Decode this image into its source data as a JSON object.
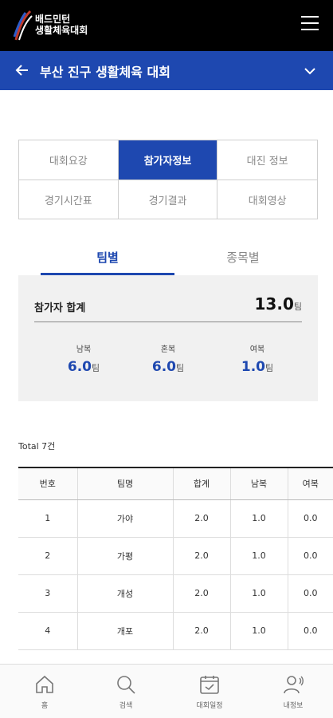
{
  "header": {
    "logo_text_line1": "배드민턴",
    "logo_text_line2": "생활체육대회",
    "title": "부산 진구 생활체육 대회"
  },
  "tabs": [
    {
      "label": "대회요강"
    },
    {
      "label": "참가자정보"
    },
    {
      "label": "대진 정보"
    },
    {
      "label": "경기시간표"
    },
    {
      "label": "경기결과"
    },
    {
      "label": "대회영상"
    }
  ],
  "subtabs": [
    {
      "label": "팀별"
    },
    {
      "label": "종목별"
    }
  ],
  "summary": {
    "total_label": "참가자 합계",
    "total_value": "13.0",
    "unit": "팀",
    "stats": [
      {
        "label": "남복",
        "value": "6.0"
      },
      {
        "label": "혼복",
        "value": "6.0"
      },
      {
        "label": "여복",
        "value": "1.0"
      }
    ]
  },
  "total_count": "Total 7건",
  "table": {
    "headers": [
      "번호",
      "팀명",
      "합계",
      "남복",
      "여복"
    ],
    "rows": [
      [
        "1",
        "가야",
        "2.0",
        "1.0",
        "0.0"
      ],
      [
        "2",
        "가평",
        "2.0",
        "1.0",
        "0.0"
      ],
      [
        "3",
        "개성",
        "2.0",
        "1.0",
        "0.0"
      ],
      [
        "4",
        "개포",
        "2.0",
        "1.0",
        "0.0"
      ]
    ]
  },
  "bottom_nav": [
    {
      "label": "홈",
      "icon": "home-icon"
    },
    {
      "label": "검색",
      "icon": "search-icon"
    },
    {
      "label": "대회일정",
      "icon": "calendar-icon"
    },
    {
      "label": "내정보",
      "icon": "user-icon"
    }
  ],
  "colors": {
    "accent": "#1e48b0",
    "topbar": "#000000"
  }
}
